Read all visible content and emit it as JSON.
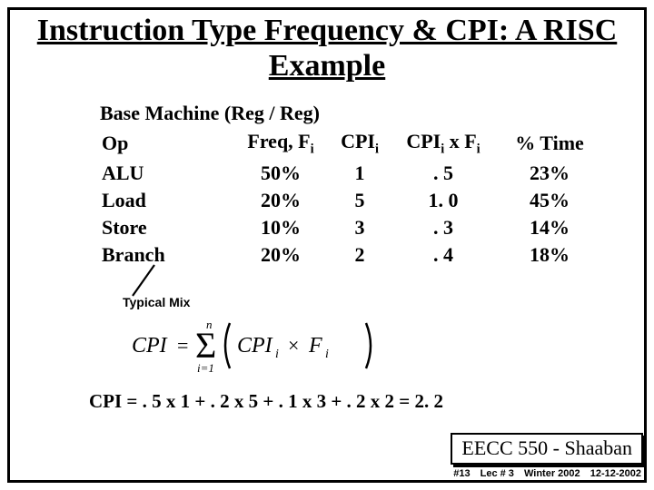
{
  "title": "Instruction Type Frequency & CPI: A RISC Example",
  "subhead": "Base Machine (Reg / Reg)",
  "header": {
    "op": "Op",
    "freq": "Freq, Fᵢ",
    "cpi": "CPIᵢ",
    "mul": "CPIᵢ x Fᵢ",
    "time": "% Time"
  },
  "rows": [
    {
      "op": "ALU",
      "freq": "50%",
      "cpi": "1",
      "mul": ". 5",
      "time": "23%"
    },
    {
      "op": "Load",
      "freq": "20%",
      "cpi": "5",
      "mul": "1. 0",
      "time": "45%"
    },
    {
      "op": "Store",
      "freq": "10%",
      "cpi": "3",
      "mul": ". 3",
      "time": "14%"
    },
    {
      "op": "Branch",
      "freq": "20%",
      "cpi": "2",
      "mul": ". 4",
      "time": "18%"
    }
  ],
  "typical": "Typical Mix",
  "formula": {
    "lhs": "CPI",
    "n": "n",
    "i": "i=1",
    "body": "CPIᵢ × Fᵢ"
  },
  "calc": "CPI   =  . 5 x 1 +  . 2 x 5  + . 1 x 3 +  . 2 x 2  = 2. 2",
  "footer": {
    "course": "EECC 550 - Shaaban",
    "slide": "#13",
    "lec": "Lec # 3",
    "term": "Winter 2002",
    "date": "12-12-2002"
  }
}
